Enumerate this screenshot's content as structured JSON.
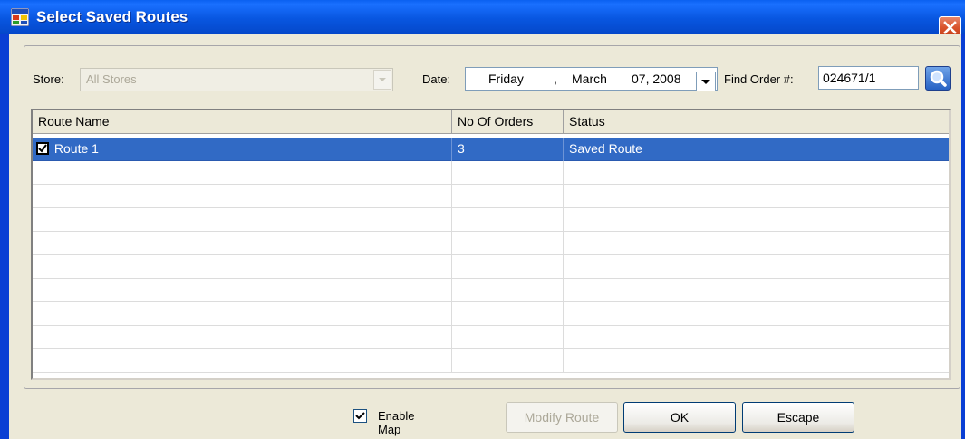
{
  "window": {
    "title": "Select Saved Routes",
    "close_icon": "close-icon"
  },
  "filters": {
    "store_label": "Store:",
    "store_value": "All Stores",
    "date_label": "Date:",
    "date_day": "Friday",
    "date_sep": ",",
    "date_month": "March",
    "date_rest": "07, 2008",
    "find_label": "Find Order #:",
    "find_value": "024671/1"
  },
  "grid": {
    "columns": [
      "Route Name",
      "No Of Orders",
      "Status"
    ],
    "rows": [
      {
        "route_name": "Route 1",
        "orders": "3",
        "status": "Saved Route",
        "checked": true,
        "selected": true
      }
    ]
  },
  "footer": {
    "enable_map_label": "Enable Map",
    "enable_map_checked": true,
    "modify_label": "Modify Route",
    "ok_label": "OK",
    "escape_label": "Escape"
  },
  "colors": {
    "titlebar": "#0856e0",
    "selection": "#316ac5",
    "client": "#ece9d8"
  }
}
